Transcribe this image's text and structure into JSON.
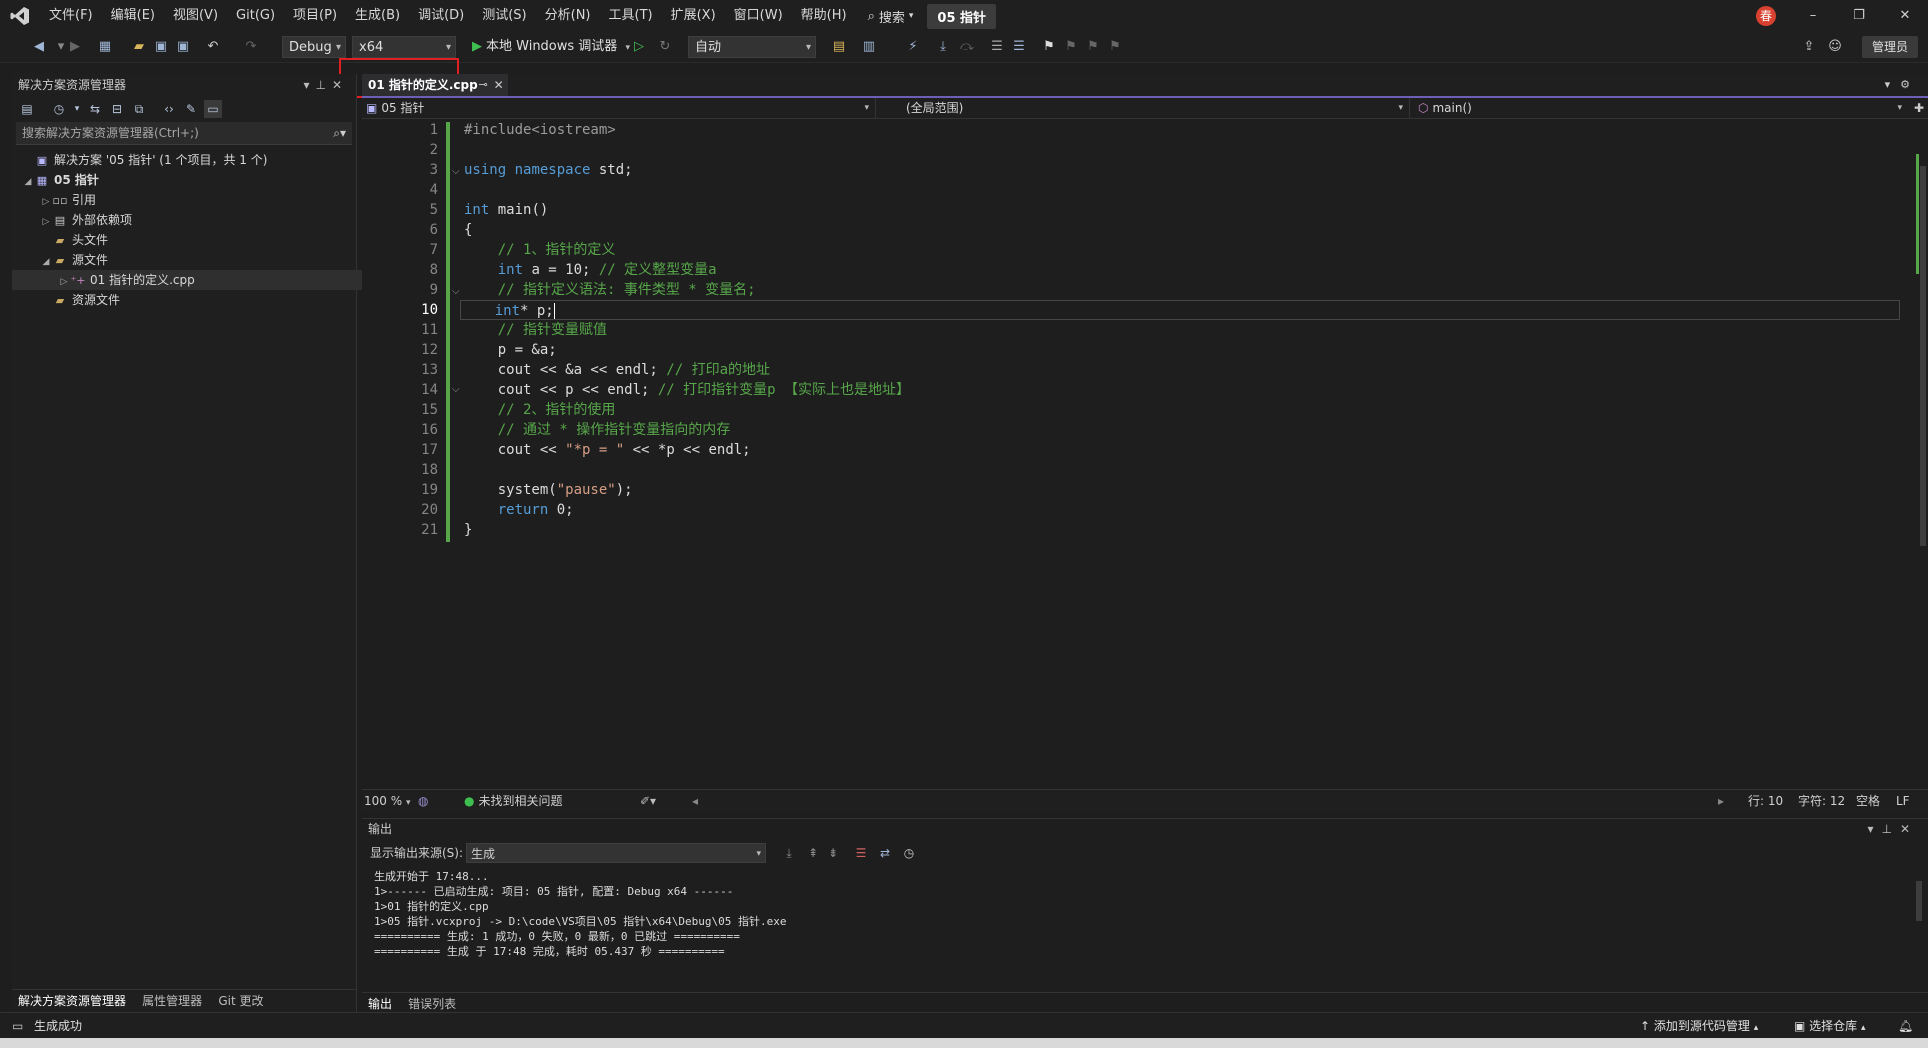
{
  "titlebar": {
    "menu": [
      "文件(F)",
      "编辑(E)",
      "视图(V)",
      "Git(G)",
      "项目(P)",
      "生成(B)",
      "调试(D)",
      "测试(S)",
      "分析(N)",
      "工具(T)",
      "扩展(X)",
      "窗口(W)",
      "帮助(H)"
    ],
    "search_label": "搜索",
    "solution_name": "05 指针",
    "avatar_text": "春",
    "window_controls": [
      "–",
      "❐",
      "✕"
    ]
  },
  "toolbar": {
    "configuration": "Debug",
    "platform": "x64",
    "run_label": "本地 Windows 调试器",
    "debug_target": "自动",
    "manage_label": "管理员",
    "highlight_color": "#e02020"
  },
  "solution_explorer": {
    "title": "解决方案资源管理器",
    "search_placeholder": "搜索解决方案资源管理器(Ctrl+;)",
    "tree": [
      {
        "label": "解决方案 '05 指针' (1 个项目，共 1 个)",
        "indent": 0,
        "twisty": "",
        "icon": "solution-icon"
      },
      {
        "label": "05 指针",
        "indent": 1,
        "twisty": "◢",
        "icon": "project-icon",
        "bold": true
      },
      {
        "label": "引用",
        "indent": 2,
        "twisty": "▷",
        "icon": "references-icon"
      },
      {
        "label": "外部依赖项",
        "indent": 2,
        "twisty": "▷",
        "icon": "external-deps-icon"
      },
      {
        "label": "头文件",
        "indent": 2,
        "twisty": "",
        "icon": "folder-icon"
      },
      {
        "label": "源文件",
        "indent": 2,
        "twisty": "◢",
        "icon": "folder-icon"
      },
      {
        "label": "01 指针的定义.cpp",
        "indent": 3,
        "twisty": "▷",
        "icon": "cpp-file-icon",
        "selected": true
      },
      {
        "label": "资源文件",
        "indent": 2,
        "twisty": "",
        "icon": "folder-icon"
      }
    ],
    "bottom_tabs": [
      "解决方案资源管理器",
      "属性管理器",
      "Git 更改"
    ]
  },
  "editor": {
    "tab_label": "01 指针的定义.cpp",
    "nav_project": "05 指针",
    "nav_scope": "(全局范围)",
    "nav_member": "main()",
    "current_line": 10,
    "lines": [
      [
        {
          "t": "pre",
          "v": "#include<iostream>"
        }
      ],
      [],
      [
        {
          "t": "kw",
          "v": "using"
        },
        {
          "t": "txt",
          "v": " "
        },
        {
          "t": "kw",
          "v": "namespace"
        },
        {
          "t": "txt",
          "v": " std;"
        }
      ],
      [],
      [
        {
          "t": "kw",
          "v": "int"
        },
        {
          "t": "txt",
          "v": " main()"
        }
      ],
      [
        {
          "t": "txt",
          "v": "{"
        }
      ],
      [
        {
          "t": "txt",
          "v": "    "
        },
        {
          "t": "com",
          "v": "// 1、指针的定义"
        }
      ],
      [
        {
          "t": "txt",
          "v": "    "
        },
        {
          "t": "kw",
          "v": "int"
        },
        {
          "t": "txt",
          "v": " a = 10; "
        },
        {
          "t": "com",
          "v": "// 定义整型变量a"
        }
      ],
      [
        {
          "t": "txt",
          "v": "    "
        },
        {
          "t": "com",
          "v": "// 指针定义语法: 事件类型 * 变量名;"
        }
      ],
      [
        {
          "t": "txt",
          "v": "    "
        },
        {
          "t": "kw",
          "v": "int"
        },
        {
          "t": "txt",
          "v": "* p;"
        }
      ],
      [
        {
          "t": "txt",
          "v": "    "
        },
        {
          "t": "com",
          "v": "// 指针变量赋值"
        }
      ],
      [
        {
          "t": "txt",
          "v": "    p = &a;"
        }
      ],
      [
        {
          "t": "txt",
          "v": "    cout << &a << endl; "
        },
        {
          "t": "com",
          "v": "// 打印a的地址"
        }
      ],
      [
        {
          "t": "txt",
          "v": "    cout << p << endl; "
        },
        {
          "t": "com",
          "v": "// 打印指针变量p 【实际上也是地址】"
        }
      ],
      [
        {
          "t": "txt",
          "v": "    "
        },
        {
          "t": "com",
          "v": "// 2、指针的使用"
        }
      ],
      [
        {
          "t": "txt",
          "v": "    "
        },
        {
          "t": "com",
          "v": "// 通过 * 操作指针变量指向的内存"
        }
      ],
      [
        {
          "t": "txt",
          "v": "    cout << "
        },
        {
          "t": "str",
          "v": "\"*p = \""
        },
        {
          "t": "txt",
          "v": " << *p << endl;"
        }
      ],
      [],
      [
        {
          "t": "txt",
          "v": "    system("
        },
        {
          "t": "str",
          "v": "\"pause\""
        },
        {
          "t": "txt",
          "v": ");"
        }
      ],
      [
        {
          "t": "txt",
          "v": "    "
        },
        {
          "t": "kw",
          "v": "return"
        },
        {
          "t": "txt",
          "v": " 0;"
        }
      ],
      [
        {
          "t": "txt",
          "v": "}"
        }
      ]
    ],
    "status": {
      "zoom": "100 %",
      "issues": "未找到相关问题",
      "line": "行: 10",
      "char": "字符: 12",
      "whitespace": "空格",
      "eol": "LF"
    }
  },
  "output": {
    "title": "输出",
    "source_label": "显示输出来源(S):",
    "source_value": "生成",
    "lines": [
      "生成开始于 17:48...",
      "1>------ 已启动生成: 项目: 05 指针, 配置: Debug x64 ------",
      "1>01 指针的定义.cpp",
      "1>05 指针.vcxproj -> D:\\code\\VS项目\\05 指针\\x64\\Debug\\05 指针.exe",
      "========== 生成: 1 成功，0 失败，0 最新，0 已跳过 ==========",
      "========== 生成 于 17:48 完成，耗时 05.437 秒 =========="
    ],
    "tabs": [
      "输出",
      "错误列表"
    ]
  },
  "statusbar": {
    "message": "生成成功",
    "source_control": "添加到源代码管理",
    "repo": "选择仓库"
  }
}
